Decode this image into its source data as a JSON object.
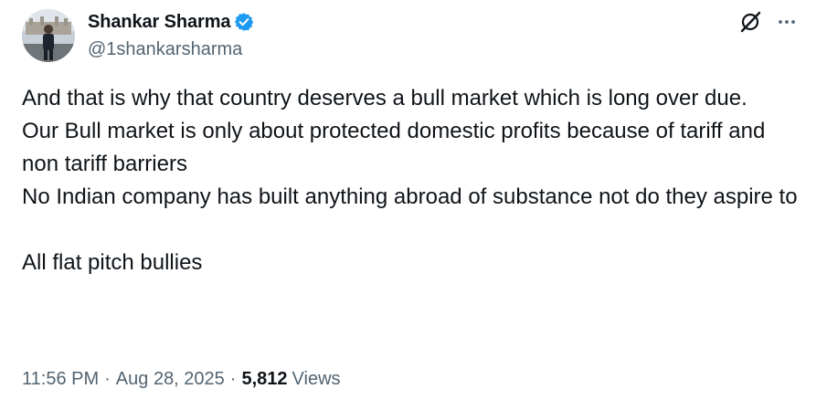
{
  "author": {
    "display_name": "Shankar Sharma",
    "handle": "@1shankarsharma",
    "verified": true,
    "verified_color": "#1d9bf0"
  },
  "icons": {
    "grok": "grok-icon",
    "more": "more-icon",
    "verified": "verified-badge-icon"
  },
  "tweet": {
    "lines": [
      "And that is why that country deserves a bull market which is long over due.",
      "Our Bull market is only about protected domestic profits because of tariff and non tariff barriers",
      "No Indian company has built anything abroad of substance not do they aspire to",
      "",
      "All flat pitch bullies"
    ]
  },
  "meta": {
    "time": "11:56 PM",
    "separator": "·",
    "date": "Aug 28, 2025",
    "views_count": "5,812",
    "views_label": "Views"
  },
  "colors": {
    "text_primary": "#0f1419",
    "text_secondary": "#536471"
  }
}
